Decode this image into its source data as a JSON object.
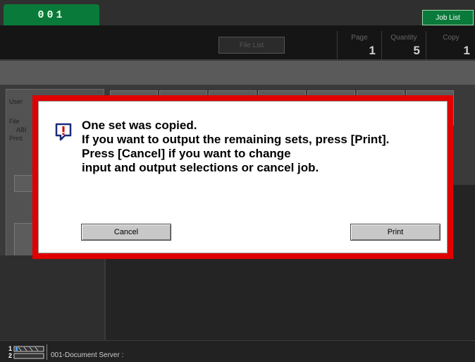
{
  "header": {
    "tab_label": "001",
    "job_list_label": "Job List",
    "file_list_label": "File List",
    "counters": [
      {
        "label": "Page",
        "value": "1"
      },
      {
        "label": "Quantity",
        "value": "5"
      },
      {
        "label": "Copy",
        "value": "1"
      }
    ]
  },
  "background": {
    "left_panel_lines": [
      "User",
      "File",
      "ABI",
      "Print"
    ]
  },
  "dialog": {
    "lines": [
      "One set was copied.",
      "If you want to output the remaining sets, press [Print].",
      "Press [Cancel] if you want to change",
      "input and output selections or cancel job."
    ],
    "cancel_label": "Cancel",
    "print_label": "Print",
    "icon": "alert-icon",
    "border_color": "#e00000"
  },
  "footer": {
    "tray_numbers": [
      "1",
      "2"
    ],
    "status_text": "001-Document Server   :"
  },
  "colors": {
    "accent_green": "#0a7a3a",
    "alert_red": "#e00000"
  }
}
